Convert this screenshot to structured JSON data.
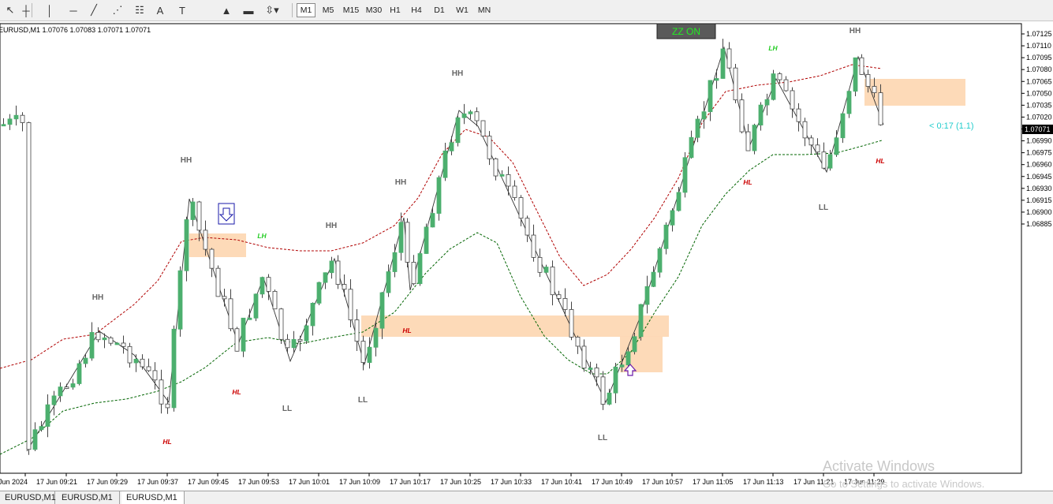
{
  "toolbar": {
    "tools": [
      {
        "icon": "cursor-icon",
        "glyph": "↖"
      },
      {
        "icon": "crosshair-icon",
        "glyph": "┼"
      },
      {
        "icon": "vertical-line-icon",
        "glyph": "│"
      },
      {
        "icon": "horizontal-line-icon",
        "glyph": "─"
      },
      {
        "icon": "trendline-icon",
        "glyph": "╱"
      },
      {
        "icon": "gann-fan-icon",
        "glyph": "⋰"
      },
      {
        "icon": "fibonacci-icon",
        "glyph": "☷"
      },
      {
        "icon": "text-icon",
        "glyph": "A"
      },
      {
        "icon": "text-label-icon",
        "glyph": "T"
      },
      {
        "icon": "triangle-icon",
        "glyph": "▲"
      },
      {
        "icon": "rectangle-icon",
        "glyph": "▬"
      },
      {
        "icon": "arrows-menu-icon",
        "glyph": "⇳▾"
      }
    ],
    "timeframes": [
      "M1",
      "M5",
      "M15",
      "M30",
      "H1",
      "H4",
      "D1",
      "W1",
      "MN"
    ],
    "active_timeframe": "M1"
  },
  "chart": {
    "symbol_info": "EURUSD,M1  1.07076 1.07083 1.07071 1.07071",
    "zz_button": "ZZ ON",
    "countdown": "< 0:17 (1.1)",
    "current_price": "1.07071",
    "colors": {
      "bull": "#4caf6e",
      "bear_fill": "#ffffff",
      "outline": "#444444",
      "zone": "#fdd8b4",
      "upper_band": "#b00000",
      "lower_band": "#006400",
      "hh": "#666666",
      "hl": "#cc0000",
      "lh": "#22cc22"
    },
    "price_axis": [
      "1.07125",
      "1.07110",
      "1.07095",
      "1.07080",
      "1.07065",
      "1.07050",
      "1.07035",
      "1.07020",
      "1.07005",
      "1.06990",
      "1.06975",
      "1.06960",
      "1.06945",
      "1.06930",
      "1.06915",
      "1.06900",
      "1.06885"
    ],
    "time_axis": [
      "Jun 2024",
      "17 Jun 09:21",
      "17 Jun 09:29",
      "17 Jun 09:37",
      "17 Jun 09:45",
      "17 Jun 09:53",
      "17 Jun 10:01",
      "17 Jun 10:09",
      "17 Jun 10:17",
      "17 Jun 10:25",
      "17 Jun 10:33",
      "17 Jun 10:41",
      "17 Jun 10:49",
      "17 Jun 10:57",
      "17 Jun 11:05",
      "17 Jun 11:13",
      "17 Jun 11:21",
      "17 Jun 11:29"
    ],
    "labels": [
      {
        "t": "HH",
        "k": "hh"
      },
      {
        "t": "HH",
        "k": "hh"
      },
      {
        "t": "HH",
        "k": "hh"
      },
      {
        "t": "HH",
        "k": "hh"
      },
      {
        "t": "HH",
        "k": "hh"
      },
      {
        "t": "HH",
        "k": "hh"
      },
      {
        "t": "LH",
        "k": "lh"
      },
      {
        "t": "LH",
        "k": "lh"
      },
      {
        "t": "HL",
        "k": "hl"
      },
      {
        "t": "HL",
        "k": "hl"
      },
      {
        "t": "HL",
        "k": "hl"
      },
      {
        "t": "HL",
        "k": "hl"
      },
      {
        "t": "HL",
        "k": "hl"
      },
      {
        "t": "LL",
        "k": "hh"
      },
      {
        "t": "LL",
        "k": "hh"
      },
      {
        "t": "LL",
        "k": "hh"
      },
      {
        "t": "LL",
        "k": "hh"
      }
    ]
  },
  "watermark": {
    "line1": "Activate Windows",
    "line2": "Go to Settings to activate Windows."
  },
  "tabs": [
    "EURUSD,M1",
    "EURUSD,M1",
    "EURUSD,M1"
  ],
  "active_tab": 2
}
